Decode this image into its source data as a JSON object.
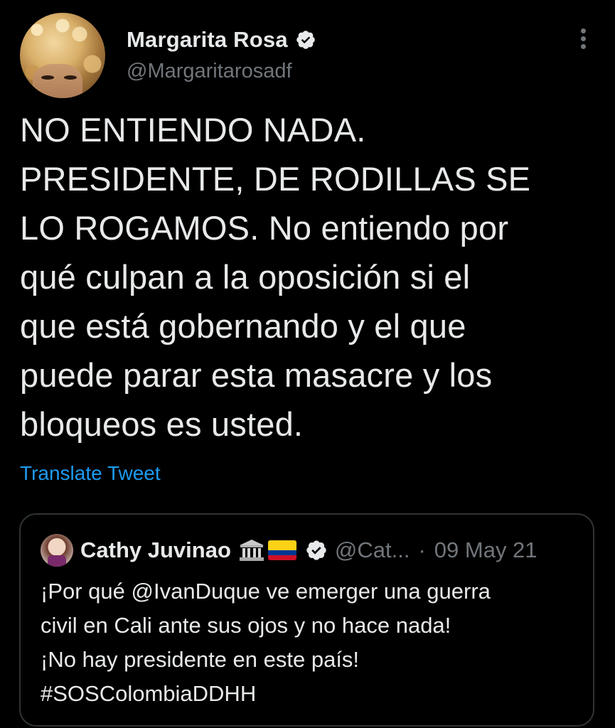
{
  "tweet": {
    "author": {
      "display_name": "Margarita Rosa",
      "handle": "@Margaritarosadf",
      "verified": true
    },
    "text": "NO ENTIENDO NADA.\nPRESIDENTE, DE RODILLAS SE\nLO ROGAMOS. No entiendo por\nqué culpan a la oposición si el\nque está gobernando y el que\npuede parar esta masacre y los\nbloqueos es usted.",
    "translate_label": "Translate Tweet"
  },
  "quoted_tweet": {
    "author": {
      "display_name": "Cathy Juvinao",
      "handle": "@Cat...",
      "verified": true
    },
    "separator": "·",
    "date": "09 May 21",
    "text_lines": [
      "¡Por qué @IvanDuque ve emerger una guerra",
      "civil en Cali ante sus ojos y no hace nada!",
      "¡No hay presidente en este país!",
      "#SOSColombiaDDHH"
    ]
  },
  "colors": {
    "background": "#000000",
    "text": "#e7e9ea",
    "secondary": "#71767b",
    "link": "#1d9bf0",
    "border": "#2f3336",
    "flag_yellow": "#fcd116",
    "flag_blue": "#003893",
    "flag_red": "#ce1126"
  },
  "icons": [
    "verified-badge-icon",
    "more-options-icon",
    "classical-building-emoji",
    "colombia-flag-emoji"
  ]
}
